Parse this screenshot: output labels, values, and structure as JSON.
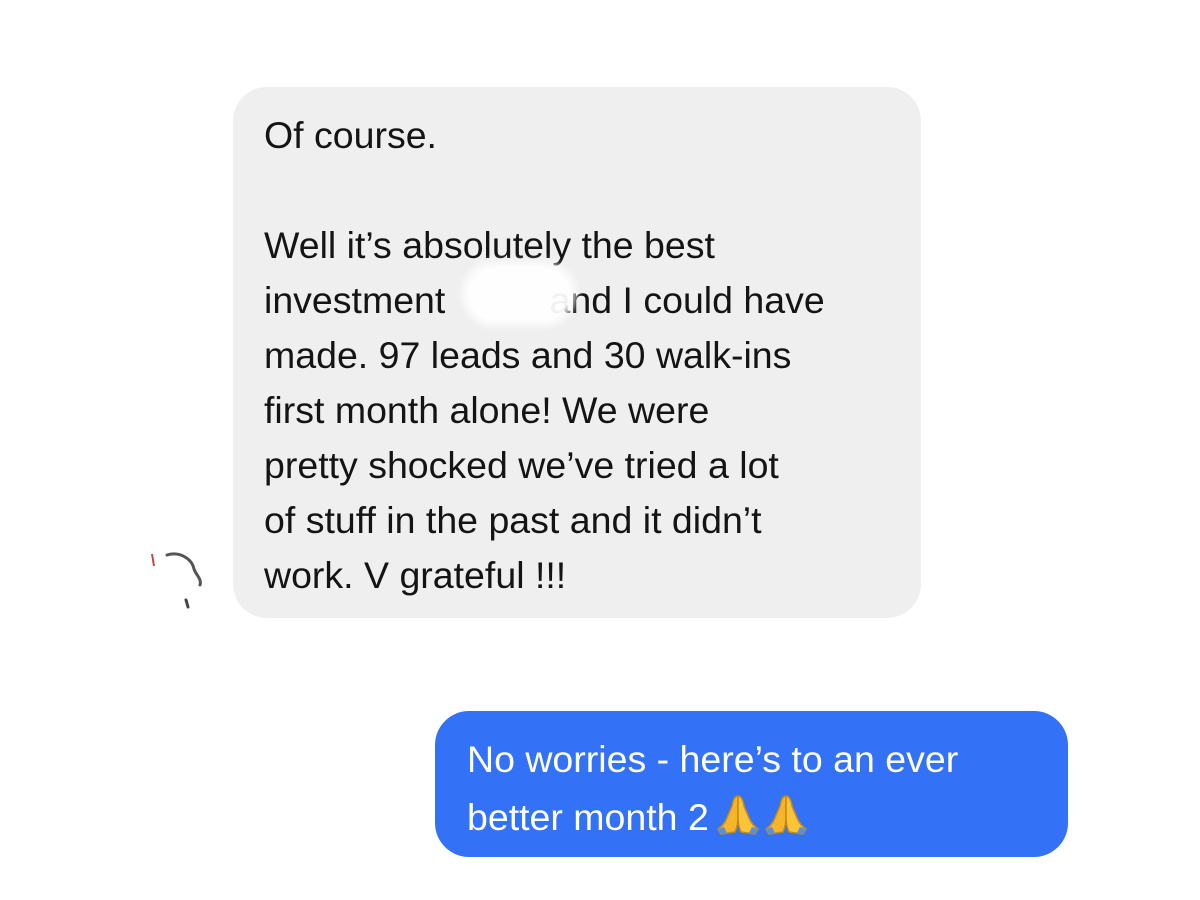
{
  "incoming_message": {
    "lines": [
      "Of course.",
      "Well it’s absolutely the best",
      "investment          and I could have",
      "made. 97 leads and 30 walk-ins",
      "first month alone! We were",
      "pretty shocked we’ve tried a lot",
      "of stuff in the past and it didn’t",
      "work. V grateful !!!"
    ],
    "bubble_color": "#efefef",
    "text_color": "#141414"
  },
  "outgoing_message": {
    "lines": [
      "No worries - here’s to an ever",
      "better month 2"
    ],
    "emoji": "folded-hands-icon x2",
    "bubble_color": "#3371f7",
    "text_color": "#ffffff"
  },
  "background_color": "#ffffff"
}
